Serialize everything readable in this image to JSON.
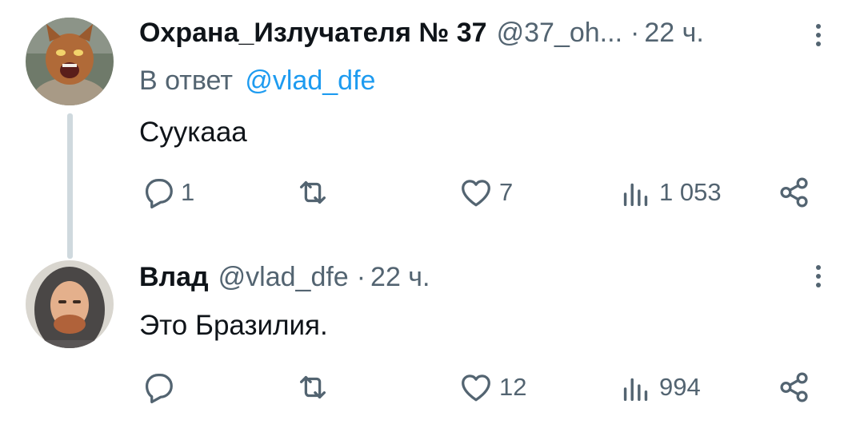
{
  "tweets": [
    {
      "author_name": "Охрана_Излучателя № 37",
      "handle": "@37_oh...",
      "separator": "·",
      "time": "22 ч.",
      "reply_to_prefix": "В ответ",
      "reply_to_handle": "@vlad_dfe",
      "text": "Суукааа",
      "replies": "1",
      "retweets": "",
      "likes": "7",
      "views": "1 053",
      "avatar_icon": "cartoon-cat-avatar"
    },
    {
      "author_name": "Влад",
      "handle": "@vlad_dfe",
      "separator": "·",
      "time": "22 ч.",
      "text": "Это Бразилия.",
      "replies": "",
      "retweets": "",
      "likes": "12",
      "views": "994",
      "avatar_icon": "hooded-man-avatar"
    }
  ],
  "colors": {
    "text_primary": "#0f1419",
    "text_secondary": "#536471",
    "link": "#1d9bf0",
    "thread_line": "#cfd9de"
  }
}
